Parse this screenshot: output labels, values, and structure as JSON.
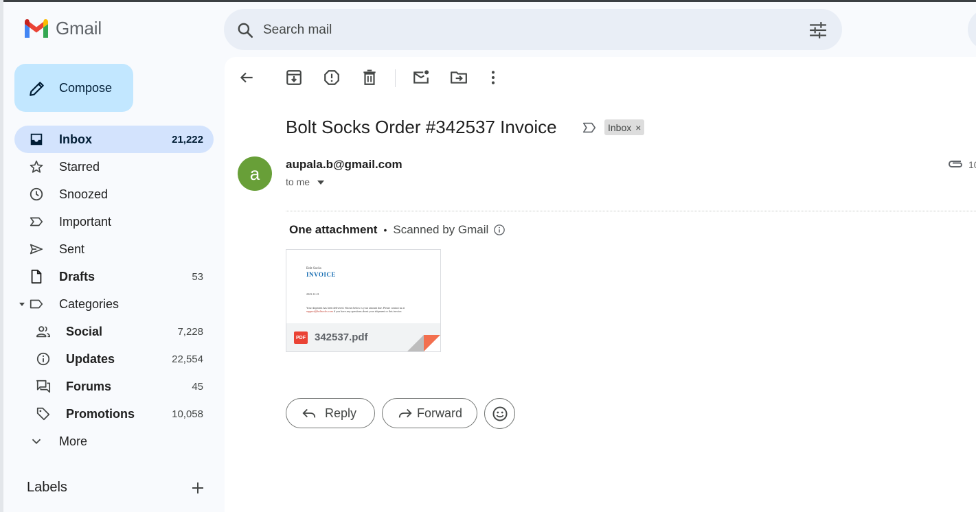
{
  "app": {
    "name": "Gmail"
  },
  "search": {
    "placeholder": "Search mail"
  },
  "compose": {
    "label": "Compose"
  },
  "sidebar": {
    "items": [
      {
        "label": "Inbox",
        "count": "21,222",
        "icon": "inbox-icon",
        "active": true
      },
      {
        "label": "Starred",
        "count": "",
        "icon": "star-icon"
      },
      {
        "label": "Snoozed",
        "count": "",
        "icon": "clock-icon"
      },
      {
        "label": "Important",
        "count": "",
        "icon": "important-icon"
      },
      {
        "label": "Sent",
        "count": "",
        "icon": "send-icon"
      },
      {
        "label": "Drafts",
        "count": "53",
        "icon": "draft-icon"
      },
      {
        "label": "Categories",
        "count": "",
        "icon": "label-icon"
      },
      {
        "label": "Social",
        "count": "7,228",
        "icon": "people-icon"
      },
      {
        "label": "Updates",
        "count": "22,554",
        "icon": "info-icon"
      },
      {
        "label": "Forums",
        "count": "45",
        "icon": "forum-icon"
      },
      {
        "label": "Promotions",
        "count": "10,058",
        "icon": "tag-icon"
      },
      {
        "label": "More",
        "count": "",
        "icon": "chevron-down-icon"
      }
    ],
    "labels_title": "Labels"
  },
  "email": {
    "subject": "Bolt Socks Order #342537 Invoice",
    "label_chip": "Inbox",
    "chip_close": "×",
    "sender_initial": "a",
    "sender_email": "aupala.b@gmail.com",
    "recipient": "to me",
    "date_partial": "10",
    "attachment_summary": "One attachment",
    "separator": "•",
    "scanned": "Scanned by Gmail",
    "attachment": {
      "filename": "342537.pdf",
      "badge": "PDF",
      "preview": {
        "company": "Bolt Socks",
        "title": "INVOICE",
        "date": "2023-12-21",
        "body": "Your shipment has been delivered. Shown below is your amount due. Please contact us at",
        "link": "support@boltsocks.com",
        "body2": "if you have any questions about your shipment or this invoice."
      }
    }
  },
  "actions": {
    "reply": "Reply",
    "forward": "Forward"
  },
  "colors": {
    "compose": "#c2e7ff",
    "active_nav": "#d3e3fd",
    "avatar": "#689f38",
    "pdf": "#ea4335"
  }
}
